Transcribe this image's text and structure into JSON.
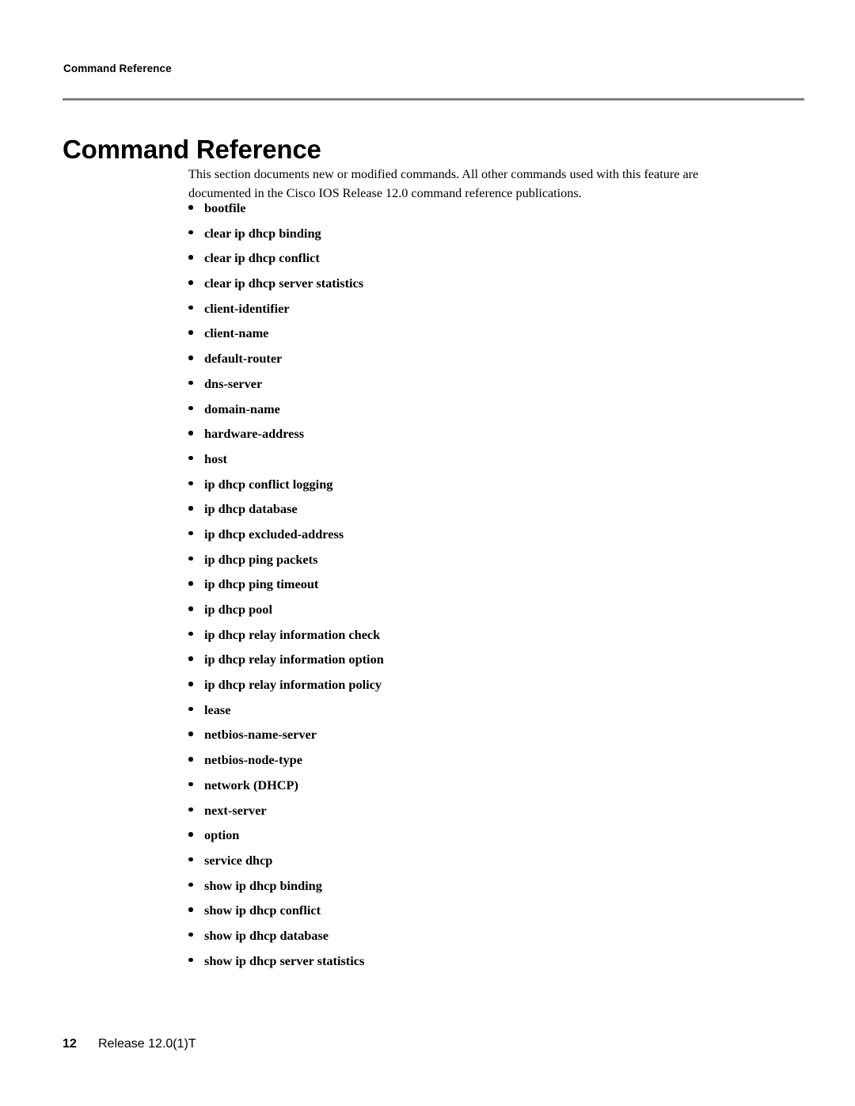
{
  "page": {
    "running_head": "Command Reference",
    "title": "Command Reference",
    "background_color": "#ffffff",
    "rule_color": "#808080"
  },
  "intro": {
    "paragraph": "This section documents new or modified commands. All other commands used with this feature are documented in the Cisco IOS Release 12.0 command reference publications."
  },
  "commands": {
    "items": [
      {
        "label": "bootfile"
      },
      {
        "label": "clear ip dhcp binding"
      },
      {
        "label": "clear ip dhcp conflict"
      },
      {
        "label": "clear ip dhcp server statistics"
      },
      {
        "label": "client-identifier"
      },
      {
        "label": "client-name"
      },
      {
        "label": "default-router"
      },
      {
        "label": "dns-server"
      },
      {
        "label": "domain-name"
      },
      {
        "label": "hardware-address"
      },
      {
        "label": "host"
      },
      {
        "label": "ip dhcp conflict logging"
      },
      {
        "label": "ip dhcp database"
      },
      {
        "label": "ip dhcp excluded-address"
      },
      {
        "label": "ip dhcp ping packets"
      },
      {
        "label": "ip dhcp ping timeout"
      },
      {
        "label": "ip dhcp pool"
      },
      {
        "label": "ip dhcp relay information check"
      },
      {
        "label": "ip dhcp relay information option"
      },
      {
        "label": "ip dhcp relay information policy"
      },
      {
        "label": "lease"
      },
      {
        "label": "netbios-name-server"
      },
      {
        "label": "netbios-node-type"
      },
      {
        "label": "network (DHCP)"
      },
      {
        "label": "next-server"
      },
      {
        "label": "option"
      },
      {
        "label": "service dhcp"
      },
      {
        "label": "show ip dhcp binding"
      },
      {
        "label": "show ip dhcp conflict"
      },
      {
        "label": "show ip dhcp database"
      },
      {
        "label": "show ip dhcp server statistics"
      }
    ]
  },
  "footer": {
    "page_number": "12",
    "release": "Release 12.0(1)T"
  }
}
